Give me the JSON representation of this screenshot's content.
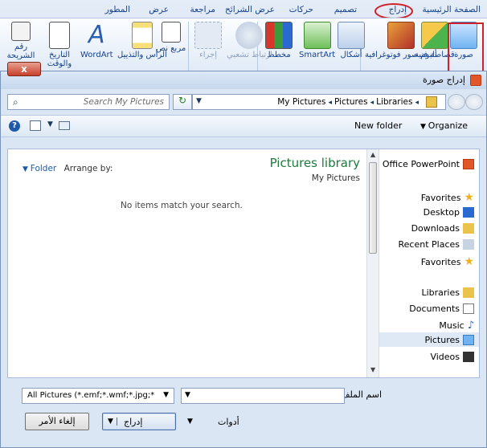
{
  "ribbon": {
    "tabs": [
      "الصفحة الرئيسية",
      "إدراج",
      "تصميم",
      "حركات",
      "عرض الشرائح",
      "مراجعة",
      "عرض",
      "المطور"
    ],
    "buttons": {
      "picture": "صورة",
      "clipart": "قصاصة فنية",
      "album": "ألبوم صور فوتوغرافية",
      "shapes": "أشكال",
      "smartart": "SmartArt",
      "chart": "مخطط",
      "hyperlink": "ارتباط تشعبي",
      "action": "إجراء",
      "textbox": "مربع نص",
      "header": "الرأس والتذييل",
      "wordart": "WordArt",
      "datetime": "التاريخ والوقت",
      "slidenum": "رقم الشريحة"
    },
    "accent_color": "#d0202a"
  },
  "dialog": {
    "title": "إدراج صورة",
    "close_label": "x",
    "search_placeholder": "Search My Pictures",
    "breadcrumbs": [
      "Libraries",
      "Pictures",
      "My Pictures"
    ],
    "toolbar": {
      "new_folder": "New folder",
      "organize": "Organize"
    },
    "library_title": "Pictures library",
    "library_subtitle": "My Pictures",
    "arrange_by_label": "Arrange by:",
    "arrange_by_value": "Folder",
    "empty_message": "No items match your search.",
    "nav": {
      "office": "Office PowerPoint",
      "favorites": "Favorites",
      "desktop": "Desktop",
      "downloads": "Downloads",
      "recent": "Recent Places",
      "favorites2": "Favorites",
      "libraries": "Libraries",
      "documents": "Documents",
      "music": "Music",
      "pictures": "Pictures",
      "videos": "Videos"
    },
    "filename_label": "اسم الملف:",
    "filename_value": "",
    "filetype_value": "All Pictures (*.emf;*.wmf;*.jpg;*",
    "tools_label": "أدوات",
    "insert_label": "إدراج",
    "cancel_label": "إلغاء الأمر"
  }
}
